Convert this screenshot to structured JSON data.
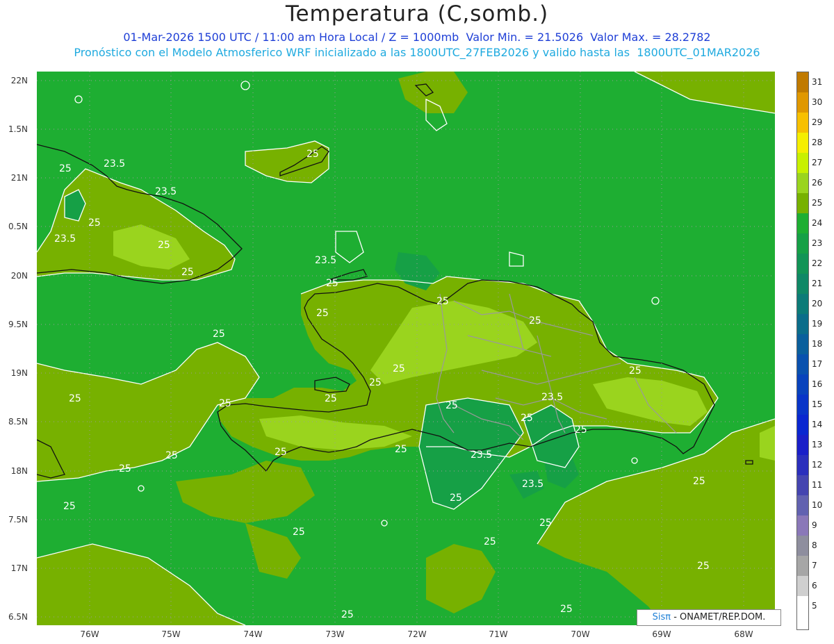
{
  "header": {
    "title": "Temperatura (C,somb.)",
    "line1": "01-Mar-2026 1500 UTC / 11:00 am Hora Local / Z = 1000mb  Valor Min. = 21.5026  Valor Max. = 28.2782",
    "line2": "Pronóstico con el Modelo Atmosferico WRF inicializado a las 1800UTC_27FEB2026 y valido hasta las  1800UTC_01MAR2026"
  },
  "axes": {
    "lat_labels": [
      "22N",
      "1.5N",
      "21N",
      "0.5N",
      "20N",
      "9.5N",
      "19N",
      "8.5N",
      "18N",
      "7.5N",
      "17N",
      "6.5N"
    ],
    "lon_labels": [
      "76W",
      "75W",
      "74W",
      "73W",
      "72W",
      "71W",
      "70W",
      "69W",
      "68W"
    ]
  },
  "contour_labels": [
    {
      "text": "25",
      "id": "c1"
    },
    {
      "text": "23.5",
      "id": "c2"
    },
    {
      "text": "25",
      "id": "c3"
    },
    {
      "text": "23.5",
      "id": "c4"
    },
    {
      "text": "25",
      "id": "c5"
    },
    {
      "text": "23.5",
      "id": "c6"
    },
    {
      "text": "25",
      "id": "c7"
    },
    {
      "text": "25",
      "id": "c8"
    },
    {
      "text": "23.5",
      "id": "c9"
    },
    {
      "text": "25",
      "id": "c10"
    },
    {
      "text": "25",
      "id": "c11"
    },
    {
      "text": "25",
      "id": "c12"
    },
    {
      "text": "25",
      "id": "c13"
    },
    {
      "text": "25",
      "id": "c14"
    },
    {
      "text": "25",
      "id": "c15"
    },
    {
      "text": "25",
      "id": "c16"
    },
    {
      "text": "25",
      "id": "c17"
    },
    {
      "text": "25",
      "id": "c18"
    },
    {
      "text": "23.5",
      "id": "c19"
    },
    {
      "text": "25",
      "id": "c20"
    },
    {
      "text": "25",
      "id": "c21"
    },
    {
      "text": "23.5",
      "id": "c22"
    },
    {
      "text": "23.5",
      "id": "c23"
    },
    {
      "text": "25",
      "id": "c24"
    },
    {
      "text": "25",
      "id": "c25"
    },
    {
      "text": "25",
      "id": "c26"
    },
    {
      "text": "25",
      "id": "c27"
    },
    {
      "text": "25",
      "id": "c28"
    },
    {
      "text": "25",
      "id": "c29"
    },
    {
      "text": "25",
      "id": "c30"
    },
    {
      "text": "25",
      "id": "c31"
    },
    {
      "text": "25",
      "id": "c32"
    },
    {
      "text": "25",
      "id": "c33"
    },
    {
      "text": "25",
      "id": "c34"
    },
    {
      "text": "25",
      "id": "c35"
    },
    {
      "text": "25",
      "id": "c36"
    },
    {
      "text": "25",
      "id": "c37"
    },
    {
      "text": "25",
      "id": "c38"
    },
    {
      "text": "25",
      "id": "c39"
    }
  ],
  "colorbar": {
    "labels": [
      "31",
      "30",
      "29",
      "28",
      "27",
      "26",
      "25",
      "24",
      "23",
      "22",
      "21",
      "20",
      "19",
      "18",
      "17",
      "16",
      "15",
      "14",
      "13",
      "12",
      "11",
      "10",
      "9",
      "8",
      "7",
      "6",
      "5"
    ],
    "colors": [
      "#c07a00",
      "#e09800",
      "#f7c000",
      "#f5ee00",
      "#c8f000",
      "#9ad41e",
      "#77b100",
      "#1eae32",
      "#16a046",
      "#129456",
      "#0f8866",
      "#0c7b78",
      "#0b6d8a",
      "#0a5f9c",
      "#0951ae",
      "#0843bc",
      "#0835c8",
      "#0a27d0",
      "#1a1fc8",
      "#2b2fbc",
      "#4545b0",
      "#6262b0",
      "#8a78b8",
      "#8e8e9e",
      "#a6a6a6",
      "#cfcfcf",
      "#ffffff"
    ]
  },
  "credit": {
    "brand": "Sis",
    "pi": "π",
    "rest": " - ONAMET/REP.DOM."
  }
}
